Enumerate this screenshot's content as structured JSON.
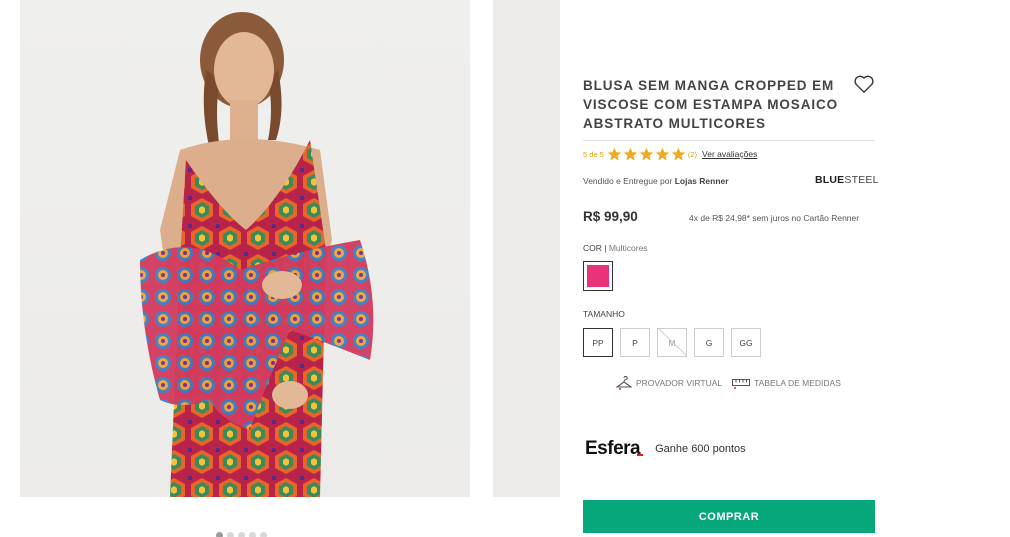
{
  "product": {
    "title": "BLUSA SEM MANGA CROPPED EM VISCOSE COM ESTAMPA MOSAICO ABSTRATO MULTICORES",
    "rating_text": "5 de 5",
    "rating_value": 5,
    "rating_max": 5,
    "rating_count": "(2)",
    "see_reviews": "Ver avaliações",
    "seller_prefix": "Vendido e Entregue por",
    "seller_name": "Lojas Renner",
    "brand_part1": "BLUE",
    "brand_part2": "STEEL",
    "price": "R$ 99,90",
    "installments": "4x de R$ 24,98* sem juros no Cartão Renner",
    "color_label": "COR",
    "color_value": "Multicores",
    "swatch_color": "#e8327a",
    "size_label": "TAMANHO",
    "sizes": [
      {
        "label": "PP",
        "selected": true,
        "available": true
      },
      {
        "label": "P",
        "selected": false,
        "available": true
      },
      {
        "label": "M",
        "selected": false,
        "available": false
      },
      {
        "label": "G",
        "selected": false,
        "available": true
      },
      {
        "label": "GG",
        "selected": false,
        "available": true
      }
    ],
    "tools": {
      "virtual_fitting": "PROVADOR VIRTUAL",
      "size_chart": "TABELA DE MEDIDAS"
    },
    "loyalty": {
      "logo": "Esfera",
      "text": "Ganhe 600 pontos"
    },
    "buy_label": "COMPRAR"
  },
  "gallery": {
    "dots": 5,
    "active_dot": 0
  },
  "colors": {
    "buy_button": "#06a77a",
    "star": "#f5a623",
    "swatch": "#e8327a"
  },
  "icons": [
    "heart-icon",
    "star-icon",
    "hanger-icon",
    "ruler-icon"
  ]
}
